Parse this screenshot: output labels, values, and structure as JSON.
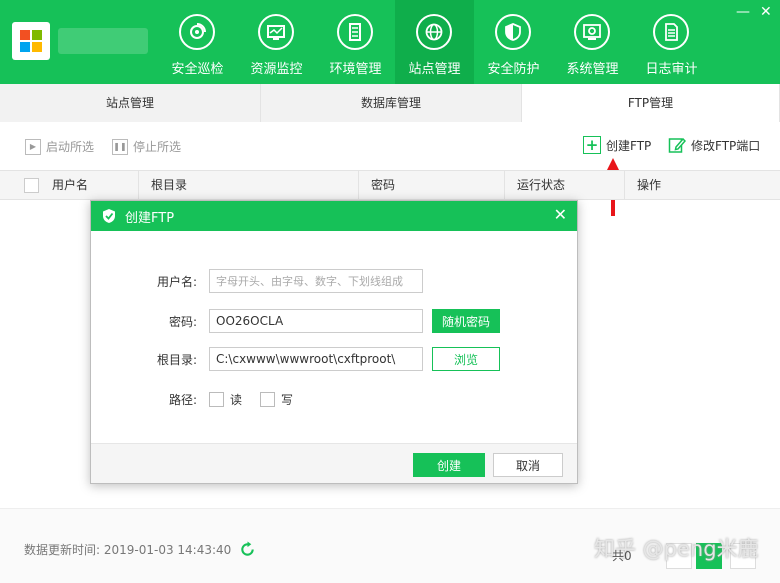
{
  "header": {
    "nav": [
      {
        "label": "安全巡检",
        "icon": "scan-icon"
      },
      {
        "label": "资源监控",
        "icon": "monitor-icon"
      },
      {
        "label": "环境管理",
        "icon": "server-icon"
      },
      {
        "label": "站点管理",
        "icon": "globe-icon",
        "active": true
      },
      {
        "label": "安全防护",
        "icon": "shield-icon"
      },
      {
        "label": "系统管理",
        "icon": "settings-icon"
      },
      {
        "label": "日志审计",
        "icon": "document-icon"
      }
    ],
    "minimize": "—",
    "close": "✕"
  },
  "tabs": [
    {
      "label": "站点管理"
    },
    {
      "label": "数据库管理"
    },
    {
      "label": "FTP管理",
      "active": true
    }
  ],
  "toolbar": {
    "start_selected": "启动所选",
    "stop_selected": "停止所选",
    "create_ftp": "创建FTP",
    "modify_port": "修改FTP端口"
  },
  "table": {
    "columns": [
      "用户名",
      "根目录",
      "密码",
      "运行状态",
      "操作"
    ]
  },
  "dialog": {
    "title": "创建FTP",
    "close": "✕",
    "username_label": "用户名:",
    "username_placeholder": "字母开头、由字母、数字、下划线组成",
    "password_label": "密码:",
    "password_value": "OO26OCLA",
    "random_password": "随机密码",
    "root_label": "根目录:",
    "root_value": "C:\\cxwww\\wwwroot\\cxftproot\\",
    "browse": "浏览",
    "path_label": "路径:",
    "read": "读",
    "write": "写",
    "create": "创建",
    "cancel": "取消"
  },
  "footer": {
    "update_time": "数据更新时间: 2019-01-03 14:43:40",
    "watermark": "知乎 @peng米鹿",
    "page_info": "共0"
  },
  "colors": {
    "accent": "#16c158",
    "arrow": "#e8151a"
  }
}
